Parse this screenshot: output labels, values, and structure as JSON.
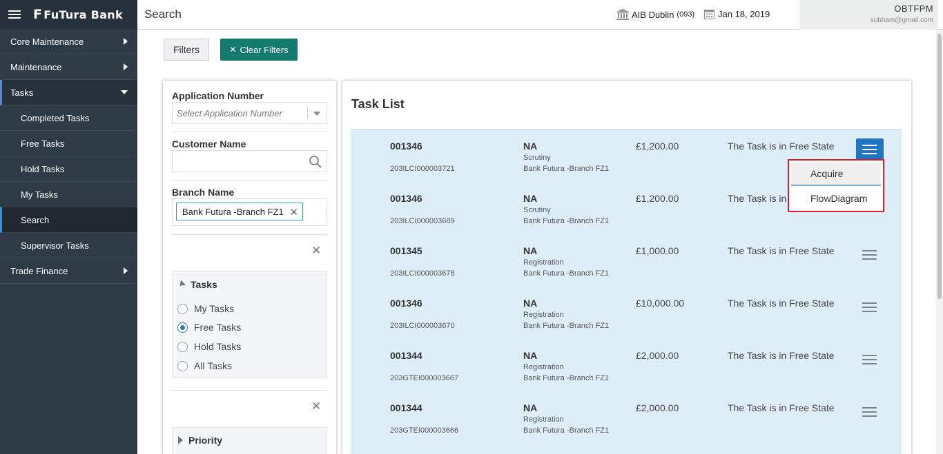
{
  "app": {
    "brand_name": "FuTura Bank",
    "brand_mark": "F",
    "page_title": "Search"
  },
  "header": {
    "branch_name": "AIB Dublin",
    "branch_code": "(093)",
    "date": "Jan 18, 2019",
    "user_name": "OBTFPM",
    "user_email": "subham@gmail.com"
  },
  "sidebar": {
    "items": [
      {
        "label": "Core Maintenance"
      },
      {
        "label": "Maintenance"
      },
      {
        "label": "Tasks"
      },
      {
        "label": "Trade Finance"
      }
    ],
    "task_subitems": [
      {
        "label": "Completed Tasks"
      },
      {
        "label": "Free Tasks"
      },
      {
        "label": "Hold Tasks"
      },
      {
        "label": "My Tasks"
      },
      {
        "label": "Search"
      },
      {
        "label": "Supervisor Tasks"
      }
    ]
  },
  "toolbar": {
    "filters_label": "Filters",
    "clear_filters_label": "Clear Filters"
  },
  "filters": {
    "application_number_label": "Application Number",
    "application_number_placeholder": "Select Application Number",
    "customer_name_label": "Customer Name",
    "customer_name_value": "",
    "branch_name_label": "Branch Name",
    "branch_name_chip": "Bank Futura -Branch FZ1",
    "tasks_section_title": "Tasks",
    "task_options": [
      {
        "label": "My Tasks",
        "selected": false
      },
      {
        "label": "Free Tasks",
        "selected": true
      },
      {
        "label": "Hold Tasks",
        "selected": false
      },
      {
        "label": "All Tasks",
        "selected": false
      }
    ],
    "priority_section_title": "Priority"
  },
  "task_list": {
    "title": "Task List",
    "rows": [
      {
        "number": "001346",
        "reference": "203ILCI000003721",
        "na": "NA",
        "stage": "Scrutiny",
        "branch": "Bank Futura -Branch FZ1",
        "amount": "£1,200.00",
        "status": "The Task is in Free State"
      },
      {
        "number": "001346",
        "reference": "203ILCI000003689",
        "na": "NA",
        "stage": "Scrutiny",
        "branch": "Bank Futura -Branch FZ1",
        "amount": "£1,200.00",
        "status": "The Task is in F"
      },
      {
        "number": "001345",
        "reference": "203ILCI000003678",
        "na": "NA",
        "stage": "Registration",
        "branch": "Bank Futura -Branch FZ1",
        "amount": "£1,000.00",
        "status": "The Task is in Free State"
      },
      {
        "number": "001346",
        "reference": "203ILCI000003670",
        "na": "NA",
        "stage": "Registration",
        "branch": "Bank Futura -Branch FZ1",
        "amount": "£10,000.00",
        "status": "The Task is in Free State"
      },
      {
        "number": "001344",
        "reference": "203GTEI000003667",
        "na": "NA",
        "stage": "Registration",
        "branch": "Bank Futura -Branch FZ1",
        "amount": "£2,000.00",
        "status": "The Task is in Free State"
      },
      {
        "number": "001344",
        "reference": "203GTEI000003666",
        "na": "NA",
        "stage": "Registration",
        "branch": "Bank Futura -Branch FZ1",
        "amount": "£2,000.00",
        "status": "The Task is in Free State"
      }
    ],
    "popup_menu": {
      "options": [
        {
          "label": "Acquire"
        },
        {
          "label": "FlowDiagram"
        }
      ]
    }
  },
  "colors": {
    "sidebar_bg": "#2e3a46",
    "accent_teal": "#137a6e",
    "accent_blue": "#1f75c2",
    "highlight_red": "#d42027",
    "list_bg": "#deeef9"
  }
}
